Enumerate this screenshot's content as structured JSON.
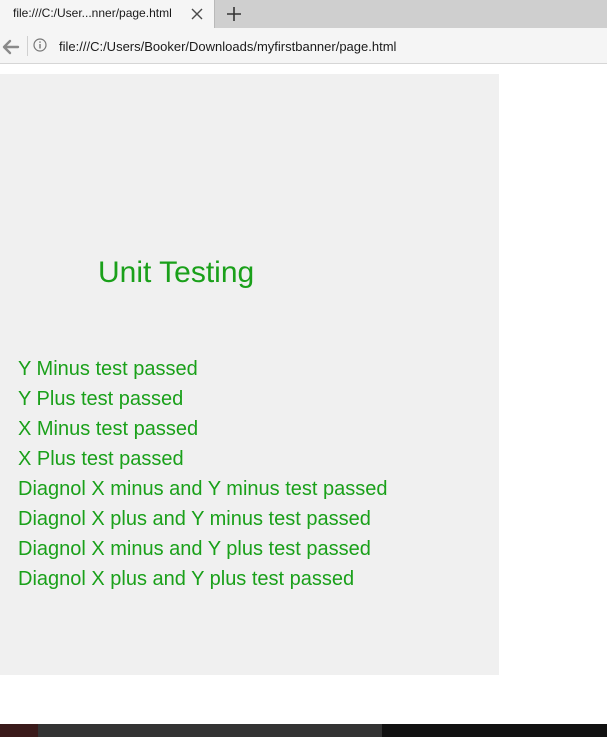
{
  "browser": {
    "tab": {
      "title": "file:///C:/User...nner/page.html"
    },
    "address_bar": {
      "url": "file:///C:/Users/Booker/Downloads/myfirstbanner/page.html"
    }
  },
  "page": {
    "heading": "Unit Testing",
    "results": [
      "Y Minus test passed",
      "Y Plus test passed",
      "X Minus test passed",
      "X Plus test passed",
      "Diagnol X minus and Y minus test passed",
      "Diagnol X plus and Y minus test passed",
      "Diagnol X minus and Y plus test passed",
      "Diagnol X plus and Y plus test passed"
    ]
  },
  "colors": {
    "text_green": "#1aa01a",
    "banner_bg": "#f0f0f0"
  },
  "icons": {
    "close": "close-icon",
    "new_tab": "plus-icon",
    "back": "back-arrow-icon",
    "info": "info-icon"
  }
}
